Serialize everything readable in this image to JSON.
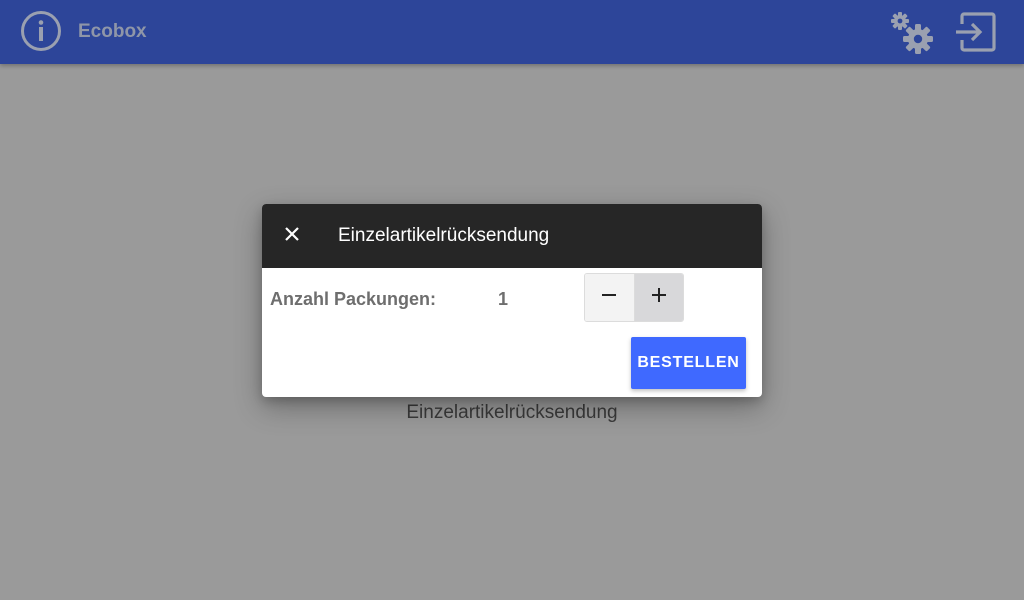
{
  "colors": {
    "appbar": "#2d4599",
    "app_title": "#8f96a8",
    "icons": "#9aa0b0",
    "dialog_header": "#262626",
    "primary_button": "#3f69ff",
    "backdrop": "#9a9a9a"
  },
  "appbar": {
    "title": "Ecobox",
    "icons": [
      "info-icon",
      "settings-gears-icon",
      "logout-icon"
    ]
  },
  "page": {
    "label": "Einzelartikelrücksendung"
  },
  "dialog": {
    "title": "Einzelartikelrücksendung",
    "close_icon": "close-icon",
    "quantity_label": "Anzahl Packungen:",
    "quantity_value": "1",
    "decrement_icon": "minus-icon",
    "increment_icon": "plus-icon",
    "order_button": "BESTELLEN"
  }
}
